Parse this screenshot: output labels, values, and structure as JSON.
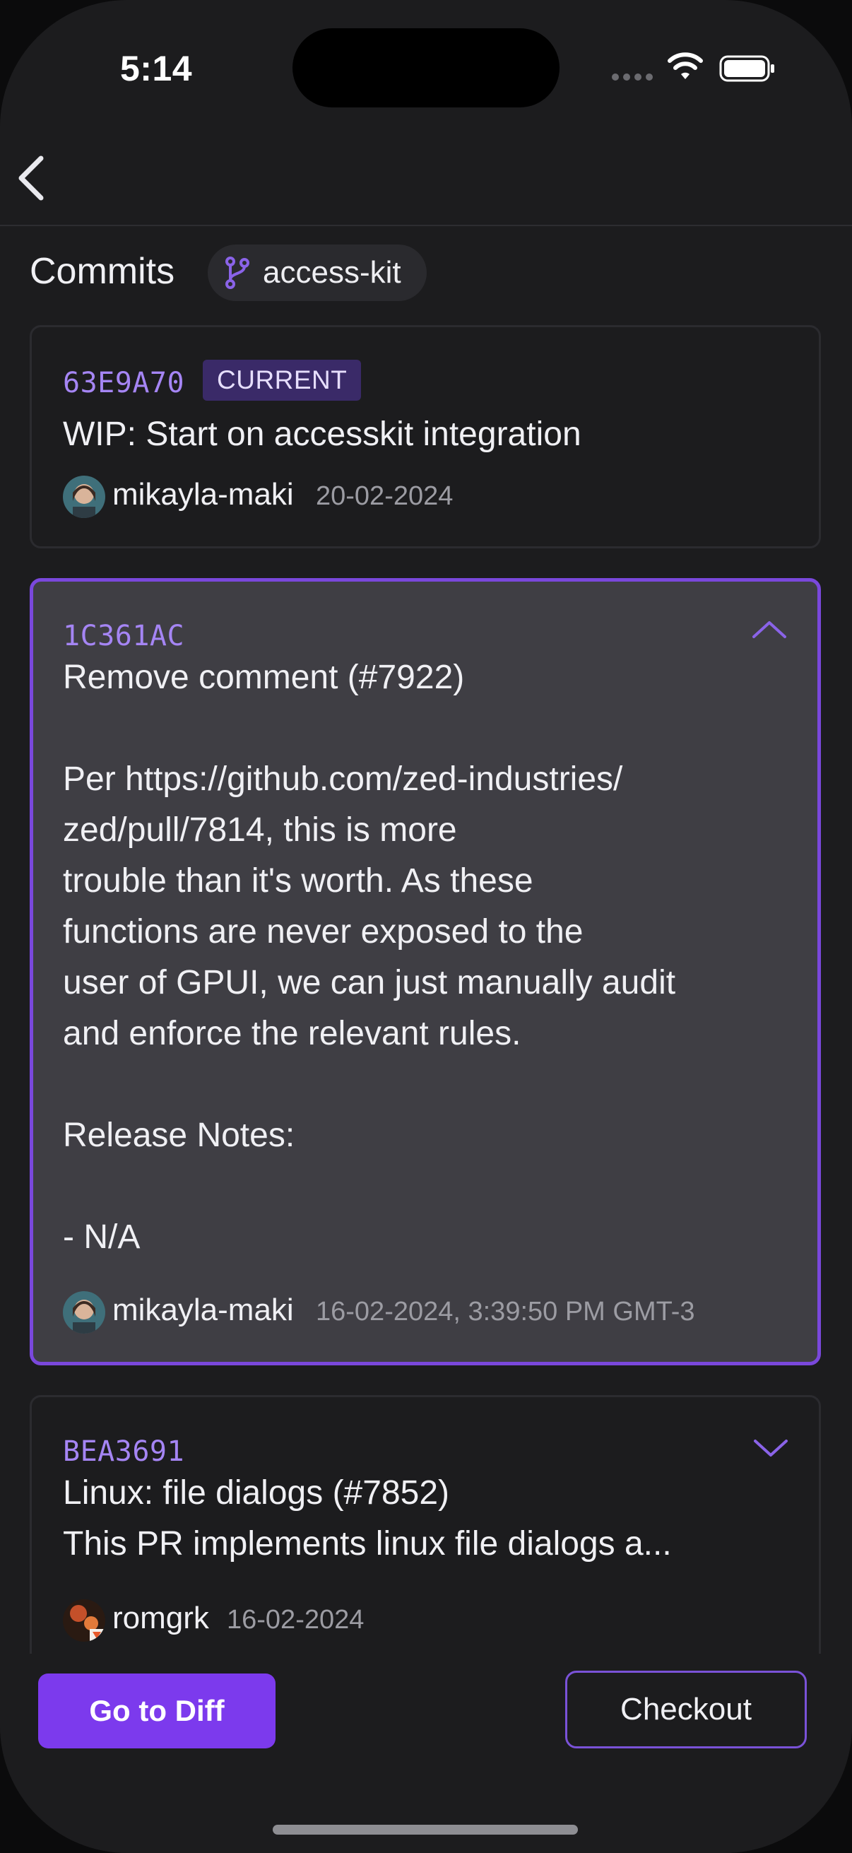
{
  "status_bar": {
    "time": "5:14"
  },
  "header": {
    "title": "Commits",
    "branch": "access-kit"
  },
  "commits": [
    {
      "hash": "63E9A70",
      "badge": "CURRENT",
      "message": "WIP: Start on accesskit integration",
      "author": "mikayla-maki",
      "date": "20-02-2024"
    },
    {
      "hash": "1C361AC",
      "message": "Remove comment (#7922)\n\nPer https://github.com/zed-industries/\nzed/pull/7814, this is more\ntrouble than it's worth. As these\nfunctions are never exposed to the\nuser of GPUI, we can just manually audit\nand enforce the relevant rules.\n\nRelease Notes:\n\n- N/A",
      "author": "mikayla-maki",
      "date": "16-02-2024, 3:39:50 PM GMT-3"
    },
    {
      "hash": "BEA3691",
      "message": "Linux: file dialogs (#7852)\nThis PR implements linux file dialogs a...",
      "author": "romgrk",
      "date": "16-02-2024"
    }
  ],
  "actions": {
    "diff_label": "Go to Diff",
    "checkout_label": "Checkout"
  },
  "colors": {
    "accent": "#7c3aed",
    "hash": "#a585f4",
    "background": "#1c1c1e"
  }
}
